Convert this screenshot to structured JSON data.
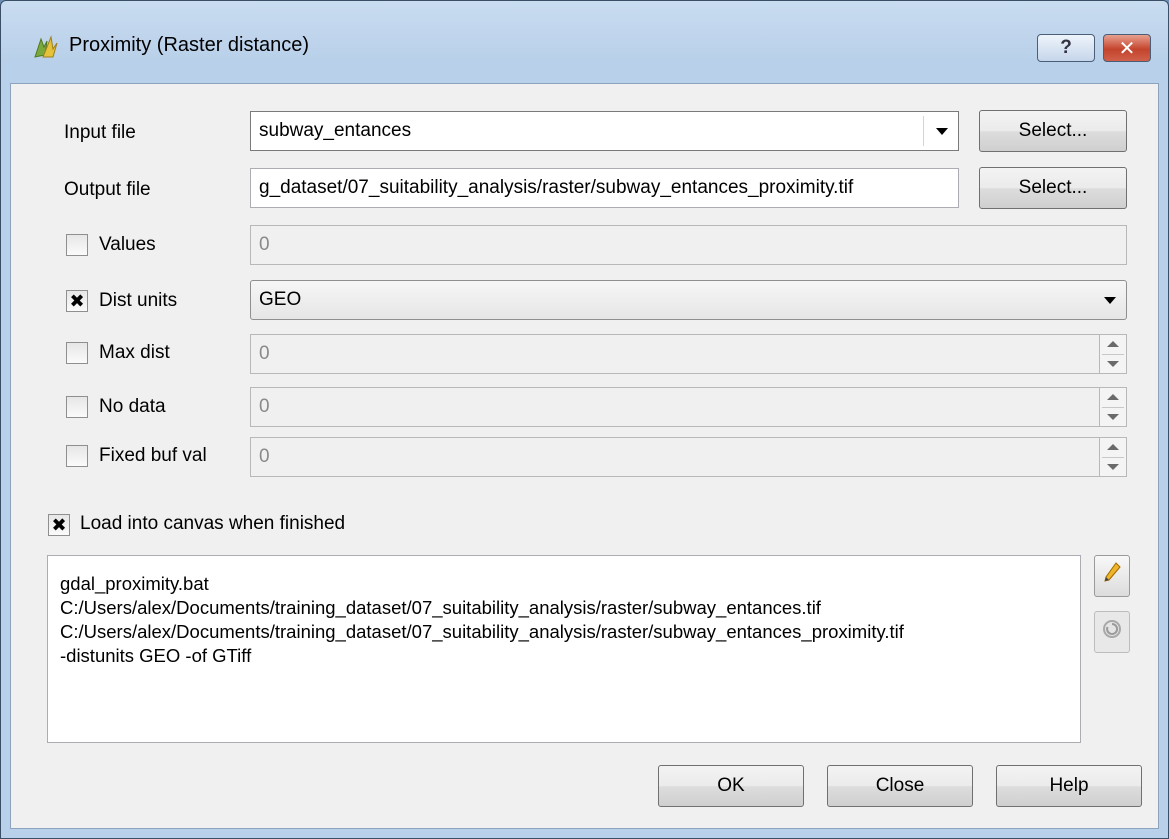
{
  "window": {
    "title": "Proximity (Raster distance)",
    "help_glyph": "?",
    "close_glyph": "✕",
    "icon": "qgis-logo-icon"
  },
  "form": {
    "input_file": {
      "label": "Input file",
      "value": "subway_entances",
      "button": "Select..."
    },
    "output_file": {
      "label": "Output file",
      "value": "g_dataset/07_suitability_analysis/raster/subway_entances_proximity.tif",
      "button": "Select..."
    },
    "values": {
      "label": "Values",
      "checked": false,
      "value": "0"
    },
    "dist_units": {
      "label": "Dist units",
      "checked": true,
      "value": "GEO"
    },
    "max_dist": {
      "label": "Max dist",
      "checked": false,
      "value": "0"
    },
    "no_data": {
      "label": "No data",
      "checked": false,
      "value": "0"
    },
    "fixed_buf_val": {
      "label": "Fixed buf val",
      "checked": false,
      "value": "0"
    }
  },
  "load_canvas": {
    "label": "Load into canvas when finished",
    "checked": true
  },
  "command": {
    "lines": [
      "gdal_proximity.bat",
      "C:/Users/alex/Documents/training_dataset/07_suitability_analysis/raster/subway_entances.tif",
      "C:/Users/alex/Documents/training_dataset/07_suitability_analysis/raster/subway_entances_proximity.tif",
      "-distunits GEO -of GTiff"
    ]
  },
  "side_buttons": {
    "edit_icon": "pencil-icon",
    "reset_icon": "reset-icon"
  },
  "buttons": {
    "ok": "OK",
    "close": "Close",
    "help": "Help"
  },
  "checkmark_glyph": "✖"
}
